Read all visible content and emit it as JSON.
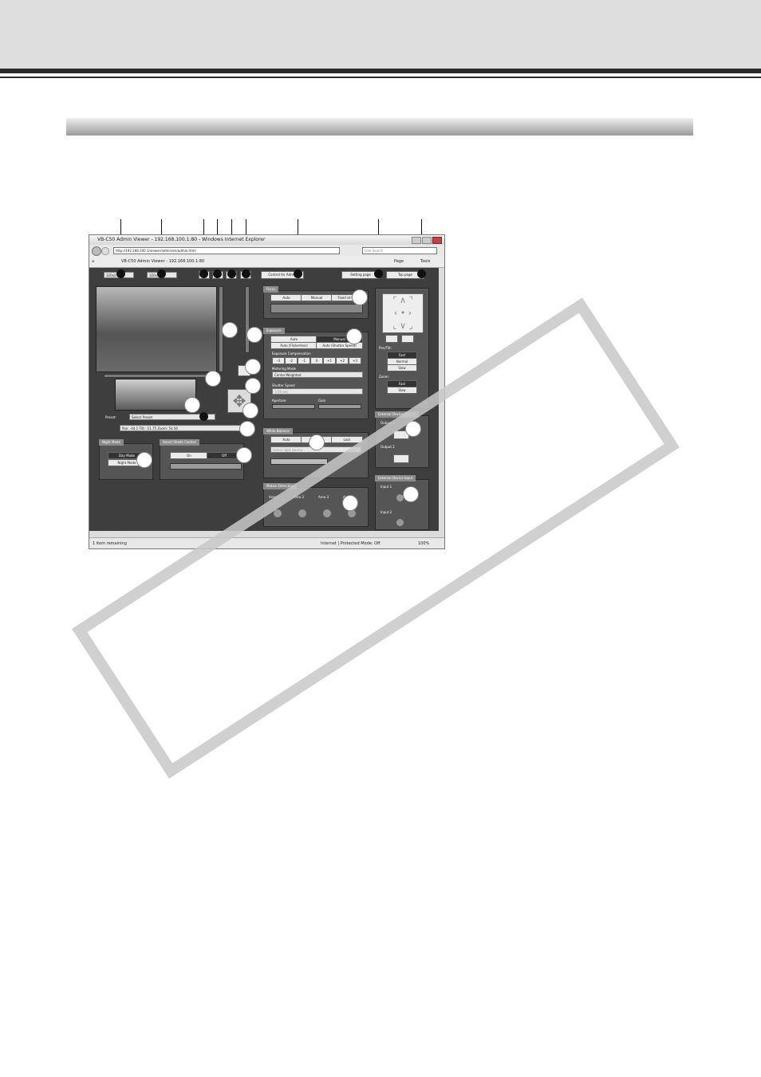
{
  "browser": {
    "window_title": "VB-C50 Admin Viewer - 192.168.100.1:80 - Windows Internet Explorer",
    "address": "http://192.168.100.1/viewer/admin/en/admin.html",
    "search_placeholder": "Live Search",
    "tab_title": "VB-C50 Admin Viewer - 192.168.100.1:80",
    "menu": {
      "page": "Page",
      "tools": "Tools"
    },
    "status_left": "1 item remaining",
    "status_zone": "Internet | Protected Mode: Off",
    "zoom": "100%"
  },
  "viewer": {
    "size_select": "320x240",
    "quality_select": "320x240",
    "control_button": "Control for Admin",
    "preset_label": "Preset:",
    "preset_select": "Select Preset",
    "pos_readout": "Pan: -44.1 Tilt: -11.75 Zoom: 54.56",
    "night_mode": {
      "title": "Night Mode",
      "day": "Day Mode",
      "night": "Night Mode"
    },
    "smart_shade": {
      "title": "Smart Shade Control",
      "on": "On",
      "off": "Off"
    }
  },
  "camera_panel": {
    "focus": {
      "title": "Focus",
      "auto": "Auto",
      "manual": "Manual",
      "fixed": "Fixed at Inf."
    },
    "exposure": {
      "title": "Exposure",
      "auto": "Auto",
      "manual": "Manual",
      "auto_flickerless": "Auto (Flickerless)",
      "auto_shutter": "Auto (Shutter Speed)",
      "comp_label": "Exposure Compensation",
      "comp_values": [
        "-3",
        "-2",
        "-1",
        "0",
        "+1",
        "+2",
        "+3"
      ],
      "metering_label": "Metering Mode",
      "metering_value": "Center-Weighted",
      "shutter_label": "Shutter Speed",
      "shutter_value": "1/30 sec",
      "aperture_label": "Aperture",
      "gain_label": "Gain"
    },
    "white_balance": {
      "title": "White Balance",
      "auto": "Auto",
      "wb": "WB",
      "lock": "Lock",
      "select_value": "Select light source"
    },
    "motion": {
      "title": "Motion Detection",
      "areas": [
        "Area 1",
        "Area 2",
        "Area 3",
        "Area 4"
      ]
    }
  },
  "ptz": {
    "setting_page": "Setting page",
    "top_page": "Top page",
    "pan_tilt_label": "Pan/Tilt:",
    "speeds": [
      "Fast",
      "Normal",
      "Slow"
    ],
    "zoom_label": "Zoom:",
    "zoom_speeds": [
      "Fast",
      "Slow"
    ],
    "ext_output": {
      "title": "External Device Output",
      "outputs": [
        "Output 1",
        "Output 2"
      ]
    },
    "ext_input": {
      "title": "External Device Input",
      "inputs": [
        "Input 1",
        "Input 2"
      ]
    }
  }
}
